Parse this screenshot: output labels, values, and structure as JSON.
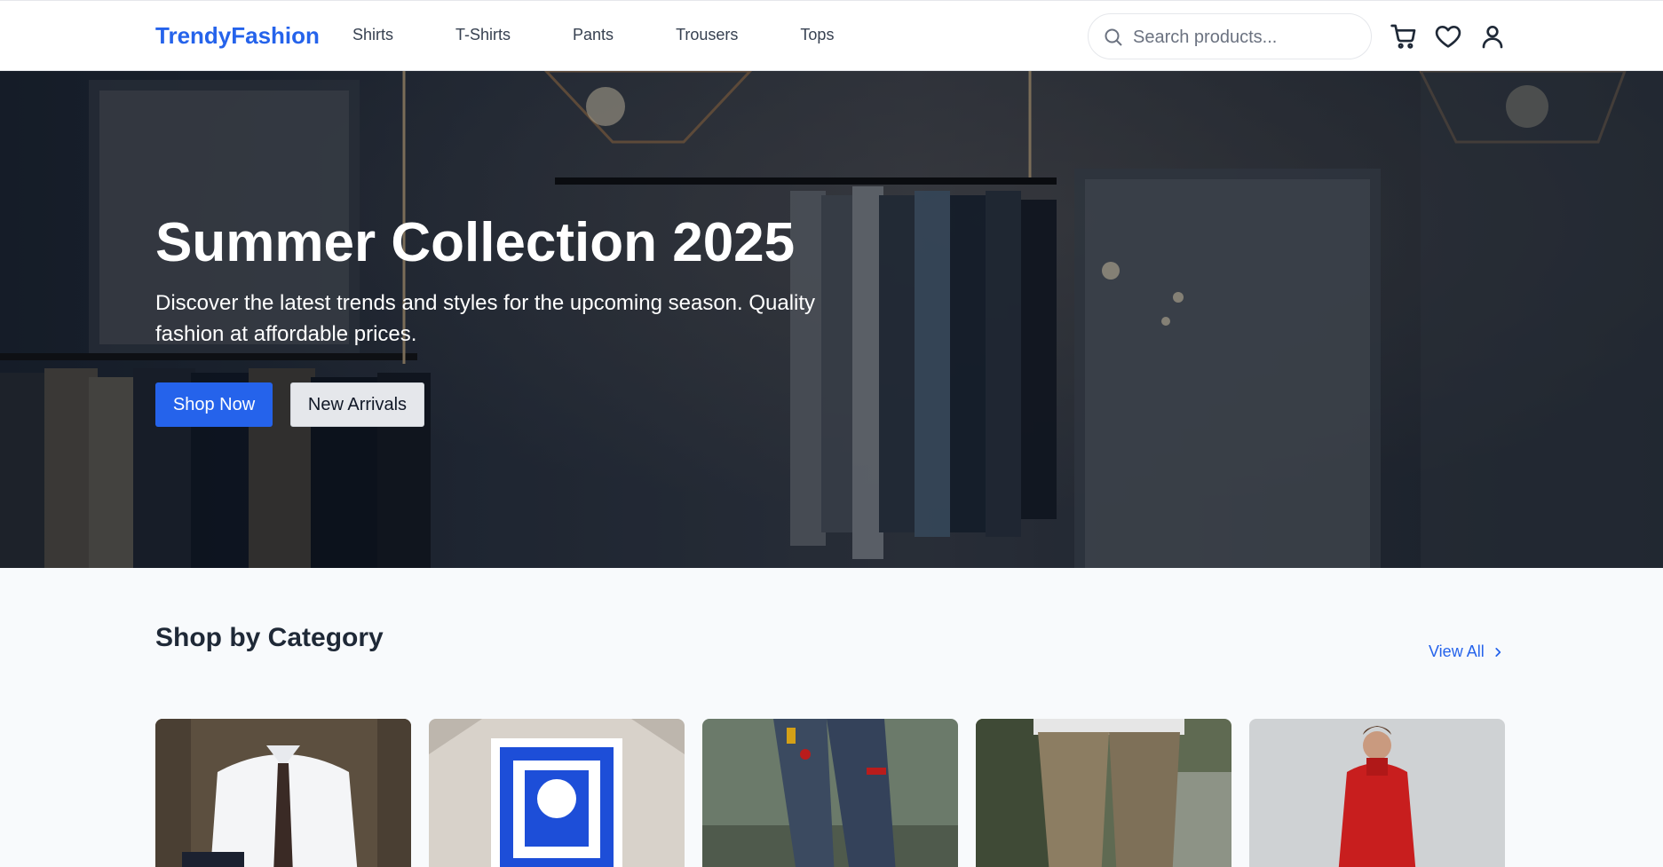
{
  "header": {
    "logo": "TrendyFashion",
    "nav": [
      "Shirts",
      "T-Shirts",
      "Pants",
      "Trousers",
      "Tops"
    ],
    "search_placeholder": "Search products...",
    "icons": [
      "search-icon",
      "cart-icon",
      "heart-icon",
      "user-icon"
    ]
  },
  "hero": {
    "title": "Summer Collection 2025",
    "subtitle": "Discover the latest trends and styles for the upcoming season. Quality fashion at affordable prices.",
    "primary_button": "Shop Now",
    "secondary_button": "New Arrivals"
  },
  "category": {
    "title": "Shop by Category",
    "view_all": "View All",
    "cards": [
      "shirts",
      "t-shirts",
      "pants",
      "trousers",
      "tops"
    ]
  },
  "colors": {
    "accent": "#2563eb",
    "background": "#f8fafc",
    "text": "#111827"
  }
}
